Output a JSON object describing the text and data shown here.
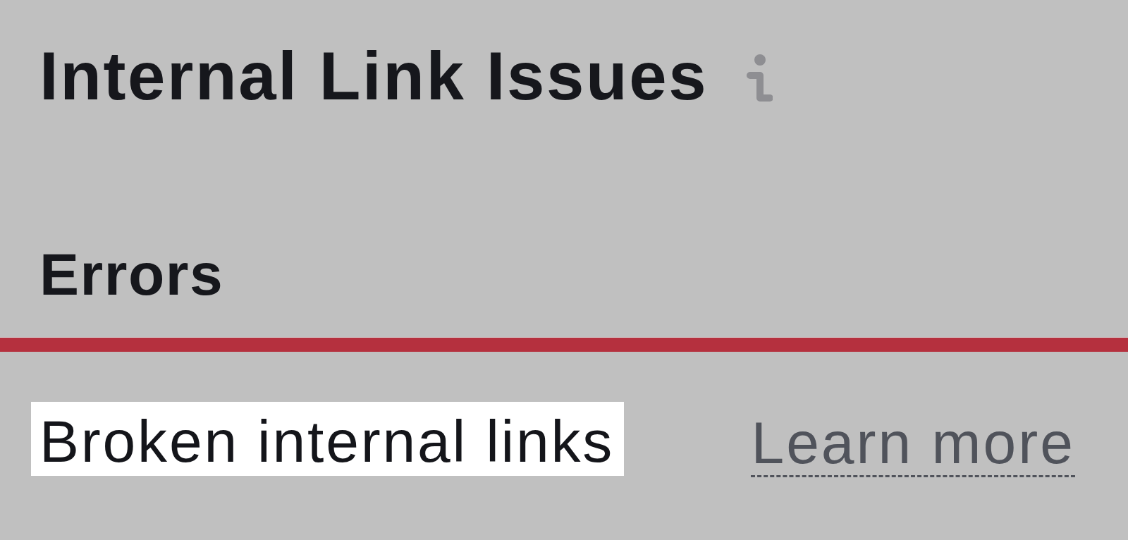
{
  "section": {
    "title": "Internal Link Issues"
  },
  "group": {
    "heading": "Errors"
  },
  "issues": [
    {
      "label": "Broken internal links",
      "highlighted": true,
      "link": "Learn more"
    }
  ]
}
